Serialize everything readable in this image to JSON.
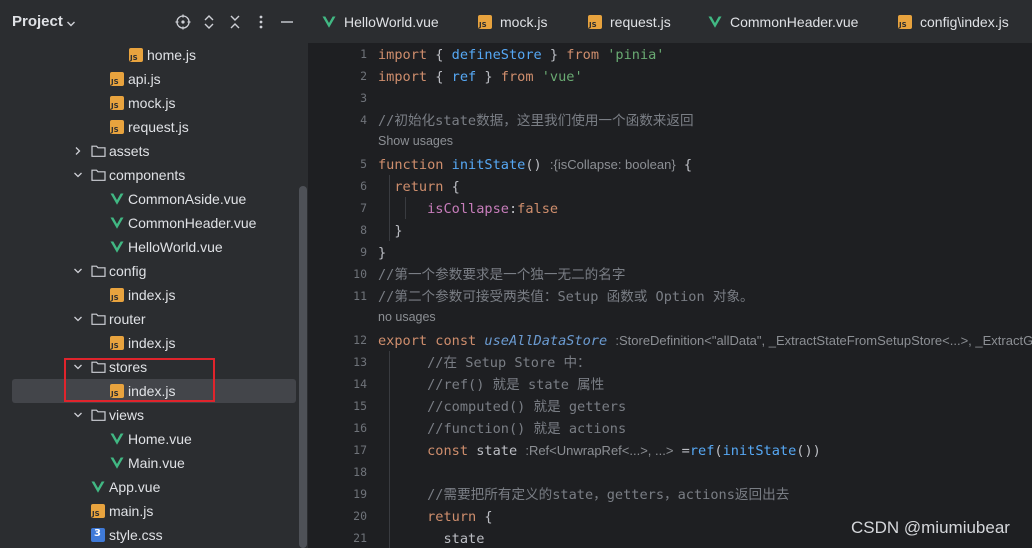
{
  "project": {
    "title": "Project",
    "header_icons": [
      "crosshair-icon",
      "expand-collapse-icon",
      "collapse-all-icon",
      "more-options-icon",
      "minimize-icon"
    ],
    "tree": [
      {
        "label": "home.js",
        "icon": "js-file-icon",
        "depth": 4,
        "arrow": "none"
      },
      {
        "label": "api.js",
        "icon": "js-file-icon",
        "depth": 3,
        "arrow": "none"
      },
      {
        "label": "mock.js",
        "icon": "js-file-icon",
        "depth": 3,
        "arrow": "none"
      },
      {
        "label": "request.js",
        "icon": "js-file-icon",
        "depth": 3,
        "arrow": "none"
      },
      {
        "label": "assets",
        "icon": "folder-icon",
        "depth": 2,
        "arrow": "collapsed"
      },
      {
        "label": "components",
        "icon": "folder-icon",
        "depth": 2,
        "arrow": "expanded"
      },
      {
        "label": "CommonAside.vue",
        "icon": "vue-file-icon",
        "depth": 3,
        "arrow": "none"
      },
      {
        "label": "CommonHeader.vue",
        "icon": "vue-file-icon",
        "depth": 3,
        "arrow": "none"
      },
      {
        "label": "HelloWorld.vue",
        "icon": "vue-file-icon",
        "depth": 3,
        "arrow": "none"
      },
      {
        "label": "config",
        "icon": "folder-icon",
        "depth": 2,
        "arrow": "expanded"
      },
      {
        "label": "index.js",
        "icon": "js-file-icon",
        "depth": 3,
        "arrow": "none"
      },
      {
        "label": "router",
        "icon": "folder-icon",
        "depth": 2,
        "arrow": "expanded"
      },
      {
        "label": "index.js",
        "icon": "js-file-icon",
        "depth": 3,
        "arrow": "none"
      },
      {
        "label": "stores",
        "icon": "folder-icon",
        "depth": 2,
        "arrow": "expanded"
      },
      {
        "label": "index.js",
        "icon": "js-file-icon",
        "depth": 3,
        "arrow": "none",
        "selected": true
      },
      {
        "label": "views",
        "icon": "folder-icon",
        "depth": 2,
        "arrow": "expanded"
      },
      {
        "label": "Home.vue",
        "icon": "vue-file-icon",
        "depth": 3,
        "arrow": "none"
      },
      {
        "label": "Main.vue",
        "icon": "vue-file-icon",
        "depth": 3,
        "arrow": "none"
      },
      {
        "label": "App.vue",
        "icon": "vue-file-icon",
        "depth": 2,
        "arrow": "none"
      },
      {
        "label": "main.js",
        "icon": "js-file-icon",
        "depth": 2,
        "arrow": "none"
      },
      {
        "label": "style.css",
        "icon": "css-file-icon",
        "depth": 2,
        "arrow": "none"
      }
    ]
  },
  "tabs": [
    {
      "label": "HelloWorld.vue",
      "icon": "vue-file-icon"
    },
    {
      "label": "mock.js",
      "icon": "js-file-icon"
    },
    {
      "label": "request.js",
      "icon": "js-file-icon"
    },
    {
      "label": "CommonHeader.vue",
      "icon": "vue-file-icon"
    },
    {
      "label": "config\\index.js",
      "icon": "js-file-icon"
    }
  ],
  "editor": {
    "lines": [
      {
        "kind": "code",
        "num": "1",
        "tokens": [
          [
            "kw",
            "import"
          ],
          [
            "txt",
            " { "
          ],
          [
            "fn",
            "defineStore"
          ],
          [
            "txt",
            " } "
          ],
          [
            "kw",
            "from"
          ],
          [
            "txt",
            " "
          ],
          [
            "str",
            "'pinia'"
          ]
        ]
      },
      {
        "kind": "code",
        "num": "2",
        "tokens": [
          [
            "kw",
            "import"
          ],
          [
            "txt",
            " { "
          ],
          [
            "fn",
            "ref"
          ],
          [
            "txt",
            " } "
          ],
          [
            "kw",
            "from"
          ],
          [
            "txt",
            " "
          ],
          [
            "str",
            "'vue'"
          ]
        ]
      },
      {
        "kind": "code",
        "num": "3",
        "tokens": []
      },
      {
        "kind": "code",
        "num": "4",
        "tokens": [
          [
            "cm",
            "//初始化state数据，这里我们使用一个函数来返回"
          ]
        ]
      },
      {
        "kind": "hint",
        "text": "Show usages"
      },
      {
        "kind": "code",
        "num": "5",
        "tokens": [
          [
            "kw",
            "function"
          ],
          [
            "txt",
            " "
          ],
          [
            "fn",
            "initState"
          ],
          [
            "txt",
            "() "
          ],
          [
            "inlay",
            ":{isCollapse: boolean}"
          ],
          [
            "txt",
            " {"
          ]
        ]
      },
      {
        "kind": "code",
        "num": "6",
        "tokens": [
          [
            "txt",
            "  "
          ],
          [
            "kw",
            "return"
          ],
          [
            "txt",
            " {"
          ]
        ]
      },
      {
        "kind": "code",
        "num": "7",
        "tokens": [
          [
            "txt",
            "      "
          ],
          [
            "prop",
            "isCollapse"
          ],
          [
            "txt",
            ":"
          ],
          [
            "kw",
            "false"
          ]
        ]
      },
      {
        "kind": "code",
        "num": "8",
        "tokens": [
          [
            "txt",
            "  }"
          ]
        ]
      },
      {
        "kind": "code",
        "num": "9",
        "tokens": [
          [
            "txt",
            "}"
          ]
        ]
      },
      {
        "kind": "code",
        "num": "10",
        "tokens": [
          [
            "cm",
            "//第一个参数要求是一个独一无二的名字"
          ]
        ]
      },
      {
        "kind": "code",
        "num": "11",
        "tokens": [
          [
            "cm",
            "//第二个参数可接受两类值：Setup 函数或 Option 对象。"
          ]
        ]
      },
      {
        "kind": "hint",
        "text": "no usages"
      },
      {
        "kind": "code",
        "num": "12",
        "tokens": [
          [
            "kw",
            "export const"
          ],
          [
            "txt",
            " "
          ],
          [
            "ital",
            "useAllDataStore"
          ],
          [
            "txt",
            " "
          ],
          [
            "inlay",
            ":StoreDefinition<\"allData\", _ExtractStateFromSetupStore<...>, _ExtractGettersFro"
          ]
        ]
      },
      {
        "kind": "code",
        "num": "13",
        "tokens": [
          [
            "txt",
            "      "
          ],
          [
            "cm",
            "//在 Setup Store 中："
          ]
        ]
      },
      {
        "kind": "code",
        "num": "14",
        "tokens": [
          [
            "txt",
            "      "
          ],
          [
            "cm",
            "//ref() 就是 state 属性"
          ]
        ]
      },
      {
        "kind": "code",
        "num": "15",
        "tokens": [
          [
            "txt",
            "      "
          ],
          [
            "cm",
            "//computed() 就是 getters"
          ]
        ]
      },
      {
        "kind": "code",
        "num": "16",
        "tokens": [
          [
            "txt",
            "      "
          ],
          [
            "cm",
            "//function() 就是 actions"
          ]
        ]
      },
      {
        "kind": "code",
        "num": "17",
        "tokens": [
          [
            "txt",
            "      "
          ],
          [
            "kw",
            "const"
          ],
          [
            "txt",
            " state "
          ],
          [
            "inlay",
            ":Ref<UnwrapRef<...>, ...>"
          ],
          [
            "txt",
            " ="
          ],
          [
            "fn",
            "ref"
          ],
          [
            "txt",
            "("
          ],
          [
            "fn",
            "initState"
          ],
          [
            "txt",
            "())"
          ]
        ]
      },
      {
        "kind": "code",
        "num": "18",
        "tokens": []
      },
      {
        "kind": "code",
        "num": "19",
        "tokens": [
          [
            "txt",
            "      "
          ],
          [
            "cm",
            "//需要把所有定义的state，getters，actions返回出去"
          ]
        ]
      },
      {
        "kind": "code",
        "num": "20",
        "tokens": [
          [
            "txt",
            "      "
          ],
          [
            "kw",
            "return"
          ],
          [
            "txt",
            " {"
          ]
        ]
      },
      {
        "kind": "code",
        "num": "21",
        "tokens": [
          [
            "txt",
            "        state"
          ]
        ]
      }
    ]
  },
  "watermark": "CSDN @miumiubear",
  "colors": {
    "panel_bg": "#2b2d30",
    "editor_bg": "#1e1f22",
    "selection": "#43454a",
    "highlight_box": "#e0242c",
    "keyword": "#cf8e6d",
    "function": "#56a8f5",
    "string": "#6aab73",
    "comment": "#7a7e85",
    "property": "#c77dbb",
    "vue_icon": "#41b883",
    "js_icon": "#e8a33e"
  }
}
